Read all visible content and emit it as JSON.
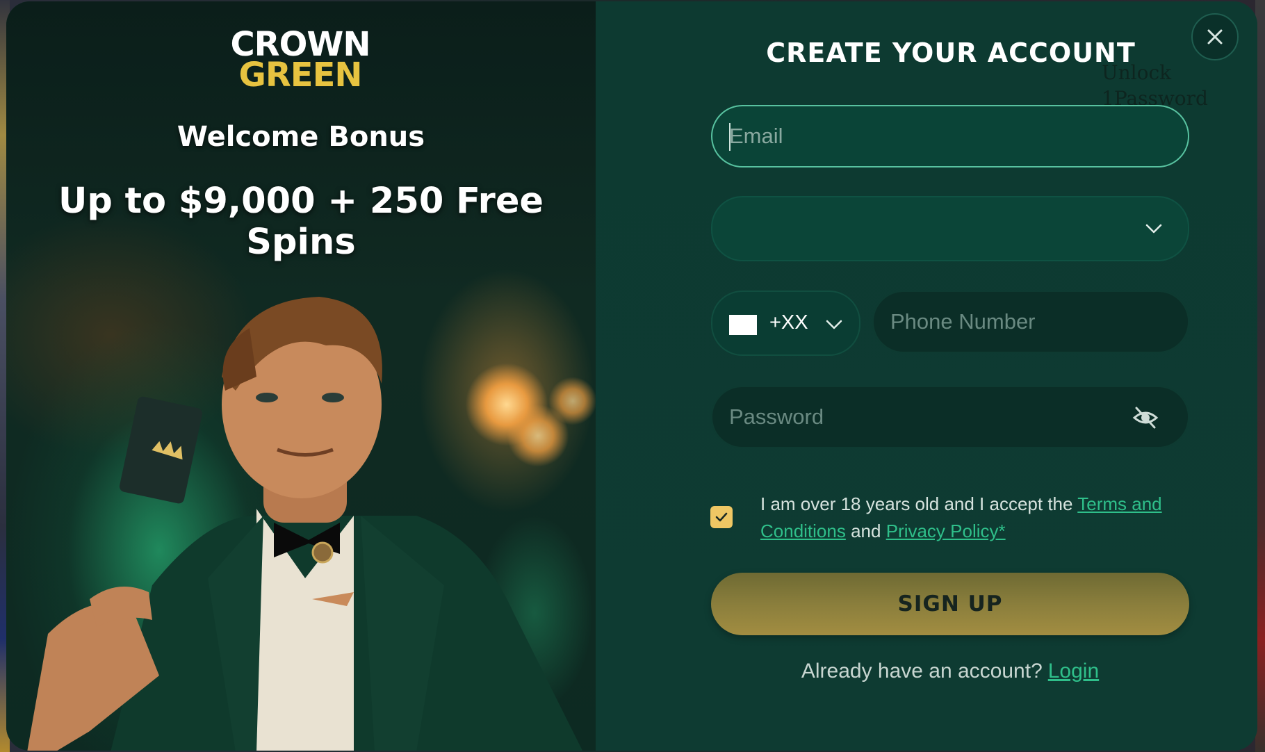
{
  "promo": {
    "logo_line1": "CROWN",
    "logo_line2": "GREEN",
    "welcome": "Welcome Bonus",
    "bonus": "Up to $9,000 + 250 Free Spins"
  },
  "form": {
    "title": "CREATE YOUR ACCOUNT",
    "email_placeholder": "Email",
    "country_code": "+XX",
    "phone_placeholder": "Phone Number",
    "password_placeholder": "Password",
    "consent_prefix": "I am over 18 years old and I accept the ",
    "terms_link": "Terms and Conditions",
    "consent_and": " and ",
    "privacy_link": "Privacy Policy*",
    "consent_checked": true,
    "signup_label": "SIGN UP",
    "login_prompt": "Already have an account?",
    "login_link": "Login"
  },
  "password_manager_hint": {
    "line1": "Unlock",
    "line2": "1Password"
  },
  "icons": {
    "close": "close-icon",
    "select_chevron": "chevron-down-icon",
    "country_chevron": "chevron-down-icon",
    "password_toggle": "eye-off-icon",
    "checkbox": "checkmark-icon"
  },
  "colors": {
    "panel_bg": "#0d3a31",
    "accent_green": "#2fbf8a",
    "email_border": "#58c2a0",
    "signup_gold": "#a28d41",
    "checkbox_gold": "#efc764"
  }
}
